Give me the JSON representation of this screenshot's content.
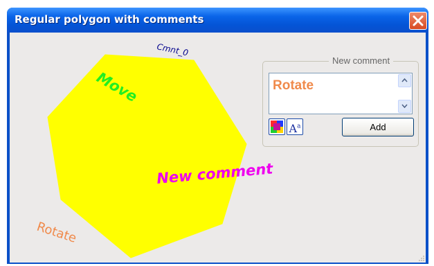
{
  "window": {
    "title": "Regular polygon with comments",
    "close_icon": "close-icon"
  },
  "canvas": {
    "polygon": {
      "shape": "regular heptagon",
      "fill": "#ffff00",
      "stroke": "#ffff00"
    },
    "comments": [
      {
        "text": "Cmnt_0",
        "color": "#00008b",
        "style": "italic"
      },
      {
        "text": "Move",
        "color": "#22ee22",
        "style": "bold italic"
      },
      {
        "text": "New comment",
        "color": "#ee00ee",
        "style": "bold italic"
      },
      {
        "text": "Rotate",
        "color": "#f08a4b",
        "style": "normal"
      }
    ]
  },
  "panel": {
    "legend": "New comment",
    "comment_value": "Rotate",
    "comment_color": "#f08a4b",
    "color_button_icon": "color-palette-icon",
    "font_button_label": "A",
    "font_button_superscript": "a",
    "add_label": "Add"
  },
  "colors": {
    "titlebar": "#0a64e8",
    "client_bg": "#eceae9",
    "close": "#d84a22"
  }
}
